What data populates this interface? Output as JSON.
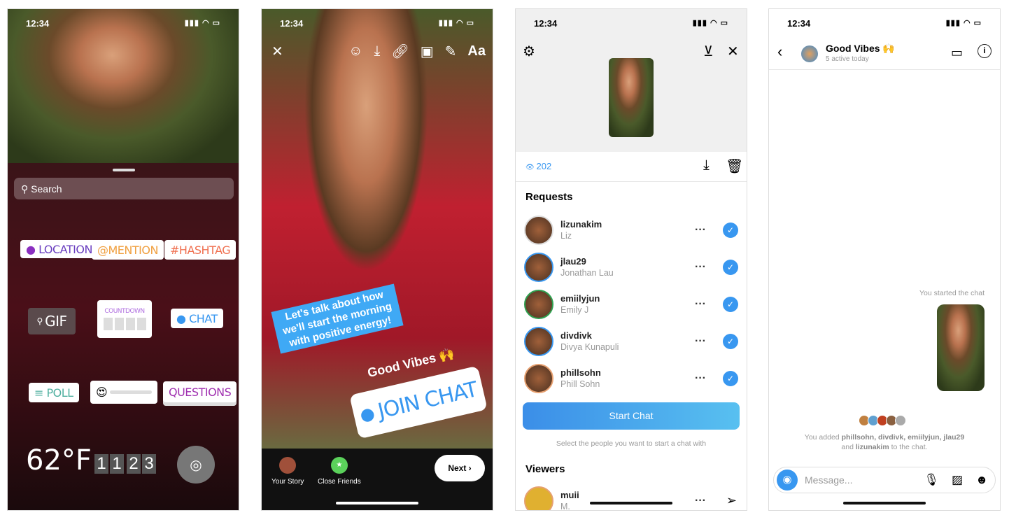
{
  "status_time": "12:34",
  "screen1": {
    "search_placeholder": "Search",
    "stickers": {
      "location": "LOCATION",
      "mention": "@MENTION",
      "hashtag": "#HASHTAG",
      "gif": "GIF",
      "countdown": "COUNTDOWN",
      "chat": "CHAT",
      "poll": "POLL",
      "slider_emoji": "😍",
      "questions": "QUESTIONS",
      "temperature": "62°F",
      "clock": [
        "1",
        "1",
        "2",
        "3"
      ]
    }
  },
  "screen2": {
    "toolbar_text": "Aa",
    "question_text": "Let's talk about how we'll start the morning with positive energy!",
    "chat_title": "Good Vibes 🙌",
    "join_chat": "JOIN CHAT",
    "your_story": "Your Story",
    "close_friends": "Close Friends",
    "next": "Next"
  },
  "screen3": {
    "views": "202",
    "requests_title": "Requests",
    "requests": [
      {
        "username": "lizunakim",
        "name": "Liz"
      },
      {
        "username": "jlau29",
        "name": "Jonathan Lau"
      },
      {
        "username": "emiilyjun",
        "name": "Emily J"
      },
      {
        "username": "divdivk",
        "name": "Divya Kunapuli"
      },
      {
        "username": "phillsohn",
        "name": "Phill Sohn"
      }
    ],
    "start_chat": "Start Chat",
    "hint": "Select the people you want to start a chat with",
    "viewers_title": "Viewers",
    "viewers": [
      {
        "username": "muii",
        "name": "M."
      }
    ]
  },
  "screen4": {
    "title": "Good Vibes 🙌",
    "subtitle": "5 active today",
    "started": "You started the chat",
    "added_prefix": "You added ",
    "added_names": "phillsohn, divdivk, emiilyjun, jlau29",
    "added_and": " and ",
    "added_last": "lizunakim",
    "added_suffix": " to the chat.",
    "message_placeholder": "Message..."
  },
  "colors": {
    "accent": "#3897f0",
    "chat_blue": "#4aa3f0"
  }
}
